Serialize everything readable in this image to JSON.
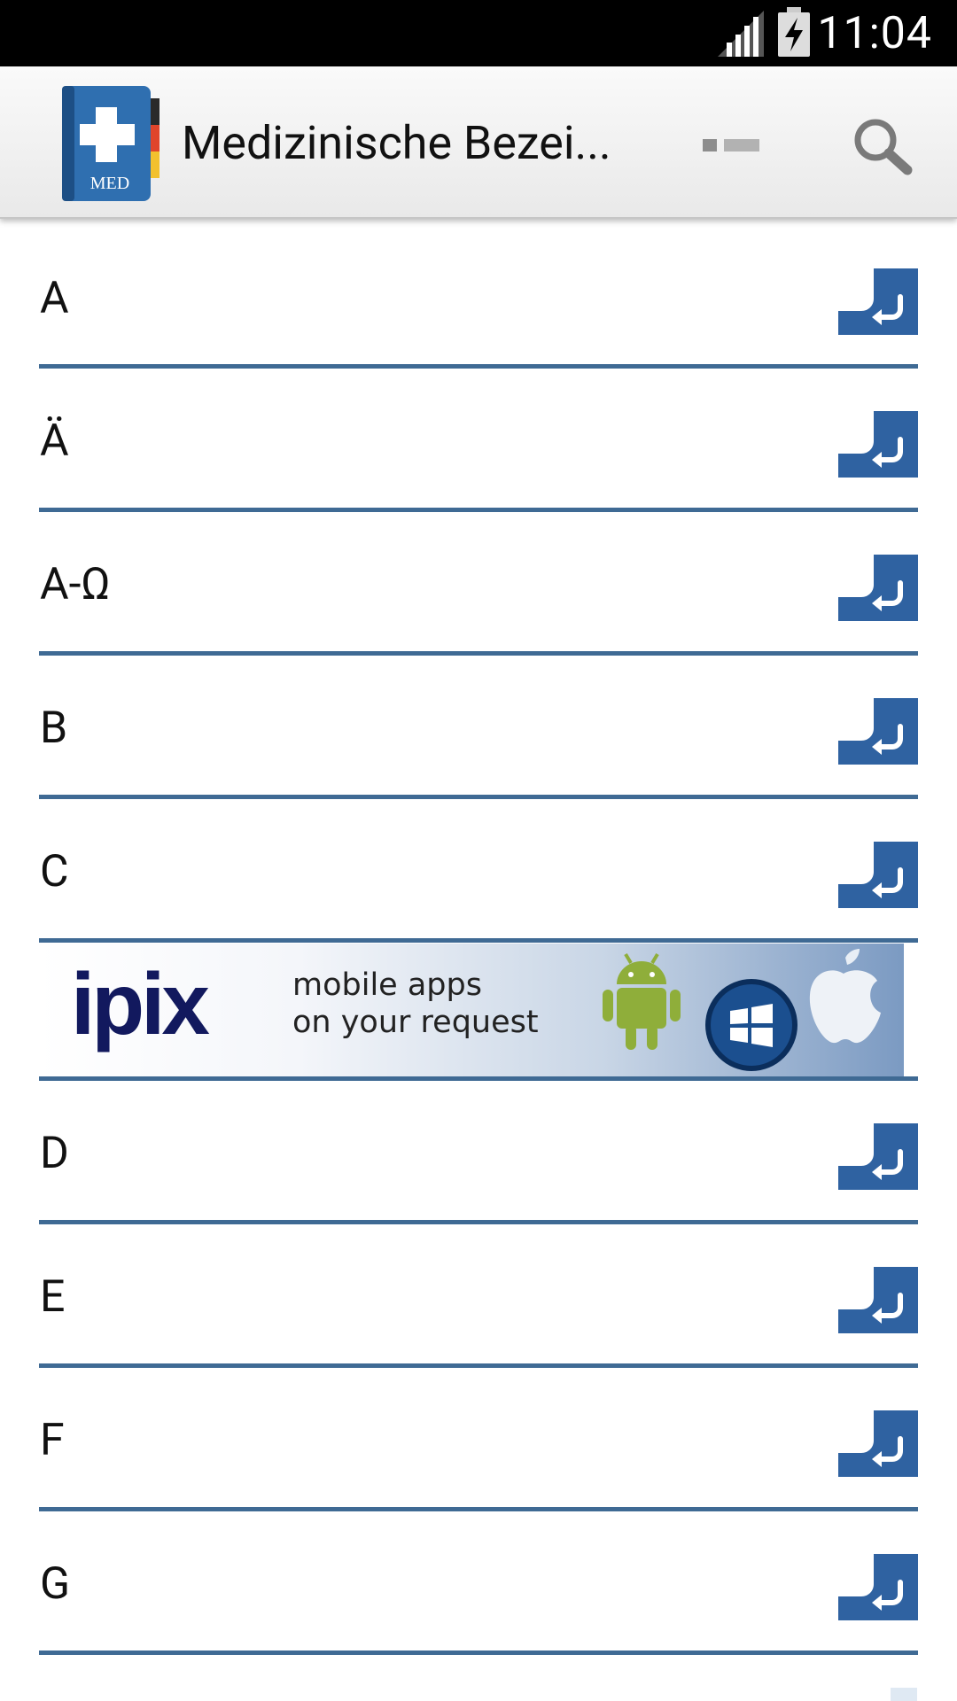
{
  "status_bar": {
    "time": "11:04",
    "icons": [
      "signal-icon",
      "battery-charging-icon"
    ]
  },
  "action_bar": {
    "app_icon": "med-book-icon",
    "app_icon_text": "MED",
    "title": "Medizinische Bezei...",
    "actions": [
      "overflow-menu-icon",
      "search-icon"
    ]
  },
  "list": {
    "items_top": [
      {
        "label": "A"
      },
      {
        "label": "Ä"
      },
      {
        "label": "A-Ω"
      },
      {
        "label": "B"
      },
      {
        "label": "C"
      }
    ],
    "items_bottom": [
      {
        "label": "D"
      },
      {
        "label": "E"
      },
      {
        "label": "F"
      },
      {
        "label": "G"
      }
    ],
    "row_action_icon": "enter-arrow-icon"
  },
  "ad_banner": {
    "brand": "ipix",
    "line1": "mobile apps",
    "line2": "on your request",
    "icons": [
      "android-icon",
      "windows-icon",
      "apple-icon"
    ]
  },
  "colors": {
    "accent": "#3f6a94",
    "button": "#2f62a1",
    "status_bar": "#000000",
    "action_bar": "#efefef"
  }
}
